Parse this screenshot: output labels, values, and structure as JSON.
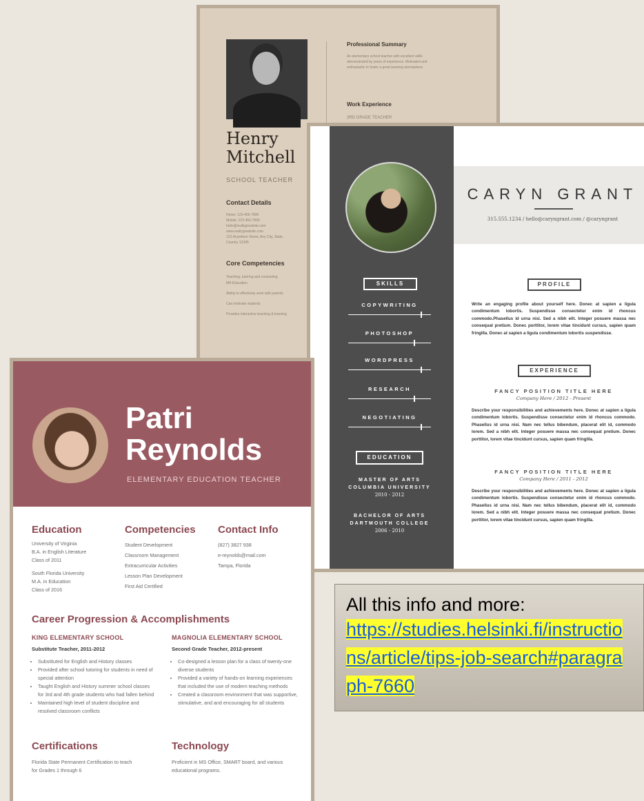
{
  "henry": {
    "name": "Henry Mitchell",
    "role": "SCHOOL TEACHER",
    "contact_title": "Contact Details",
    "contact_lines": [
      "Home: 123-456-7890",
      "Mobile: 123-456-7890",
      "hello@reallygreatsite.com",
      "www.reallygreatsite.com",
      "123 Anywhere Street, Any City, State,",
      "Country 12345"
    ],
    "competencies_title": "Core Competencies",
    "competencies": [
      "Teaching, tutoring and counseling",
      "MA Education",
      "Ability to effectively work with parents",
      "Can motivate students",
      "Provides interactive teaching & learning"
    ],
    "summary_title": "Professional Summary",
    "summary": "An elementary school teacher with excellent skills demonstrated by years of experience. Motivated and enthusiastic to foster a great learning atmosphere.",
    "experience_title": "Work Experience",
    "experience_role": "3RD GRADE TEACHER"
  },
  "caryn": {
    "name": "CARYN GRANT",
    "contact": "315.555.1234  /  hello@caryngrant.com  /  @caryngrant",
    "skills_label": "SKILLS",
    "skills": [
      {
        "name": "COPYWRITING",
        "level": 0.88
      },
      {
        "name": "PHOTOSHOP",
        "level": 0.8
      },
      {
        "name": "WORDPRESS",
        "level": 0.88
      },
      {
        "name": "RESEARCH",
        "level": 0.8
      },
      {
        "name": "NEGOTIATING",
        "level": 0.88
      }
    ],
    "education_label": "EDUCATION",
    "education": [
      {
        "degree": "MASTER OF ARTS",
        "school": "COLUMBIA UNIVERSITY",
        "years": "2010 - 2012"
      },
      {
        "degree": "BACHELOR OF ARTS",
        "school": "DARTMOUTH COLLEGE",
        "years": "2006 - 2010"
      }
    ],
    "profile_label": "PROFILE",
    "profile_text": "Write an engaging profile about yourself here. Donec at sapien a ligula condimentum lobortis. Suspendisse consectetur enim id rhoncus commodo.Phasellus id urna nisi. Sed a nibh elit. Integer posuere massa nec consequat pretium. Donec porttitor, lorem vitae tincidunt cursus, sapien quam fringilla. Donec at sapien a ligula condimentum lobortis suspendisse.",
    "experience_label": "EXPERIENCE",
    "jobs": [
      {
        "title": "FANCY POSITION TITLE HERE",
        "company": "Company Here / 2012 - Present",
        "text": "Describe your responsibilities and achievements here. Donec at sapien a ligula condimentum lobortis. Suspendisse consectetur enim id rhoncus commodo. Phasellus id urna nisi. Nam nec tellus bibendum, placerat elit id, commodo lorem. Sed a nibh elit. Integer posuere massa nec consequat pretium. Donec porttitor, lorem vitae tincidunt cursus, sapien quam fringilla."
      },
      {
        "title": "FANCY POSITION TITLE HERE",
        "company": "Company Here / 2011 - 2012",
        "text": "Describe your responsibilities and achievements here. Donec at sapien a ligula condimentum lobortis. Suspendisse consectetur enim id rhoncus commodo. Phasellus id urna nisi. Nam nec tellus bibendum, placerat elit id, commodo lorem. Sed a nibh elit. Integer posuere massa nec consequat pretium. Donec porttitor, lorem vitae tincidunt cursus, sapien quam fringilla."
      }
    ]
  },
  "patricia": {
    "name_line1": "Patri",
    "name_line2": "Reynolds",
    "role": "ELEMENTARY EDUCATION TEACHER",
    "education_title": "Education",
    "education_lines": [
      "University of Virginia",
      "B.A. in English Literature",
      "Class of 2011",
      "",
      "South Florida University",
      "M.A. in Education",
      "Class of 2016"
    ],
    "competencies_title": "Competencies",
    "competencies": [
      "Student Development",
      "Classroom Management",
      "Extracurricular Activities",
      "Lesson Plan Development",
      "First Aid Certified"
    ],
    "contact_title": "Contact Info",
    "contact_lines": [
      "(827) 3827 938",
      "e-reynolds@mail.com",
      "Tampa, Florida"
    ],
    "career_title": "Career Progression & Accomplishments",
    "jobs": [
      {
        "school": "KING ELEMENTARY SCHOOL",
        "position": "Substitute Teacher, 2011-2012",
        "bullets": [
          "Substituted for English and History classes",
          "Provided after school tutoring for students in need of special attention",
          "Taught English and History summer school classes for 3rd and 4th grade students who had fallen behind",
          "Maintained high level of student discipline and resolved classroom conflicts"
        ]
      },
      {
        "school": "MAGNOLIA ELEMENTARY SCHOOL",
        "position": "Second Grade Teacher, 2012-present",
        "bullets": [
          "Co-designed a lesson plan for a class of twenty-one diverse students",
          "Provided a variety of hands-on learning experiences that included the use of modern teaching methods",
          "Created a classroom environment that was supportive, stimulative, and and encouraging for all students"
        ]
      }
    ],
    "certifications_title": "Certifications",
    "certifications_text": "Florida State Permanent Certification to teach for Grades 1 through 6",
    "technology_title": "Technology",
    "technology_text": "Proficient in MS Office, SMART board, and various educational programs."
  },
  "info": {
    "lead": "All this info and more:",
    "link": "https://studies.helsinki.fi/instructions/article/tips-job-search#paragraph-7660"
  },
  "colors": {
    "background": "#ebe7df",
    "patricia_accent": "#9a5a61",
    "henry_bg": "#dccfbe",
    "caryn_sidebar": "#4d4d4d",
    "link_highlight": "#ffff2e"
  }
}
